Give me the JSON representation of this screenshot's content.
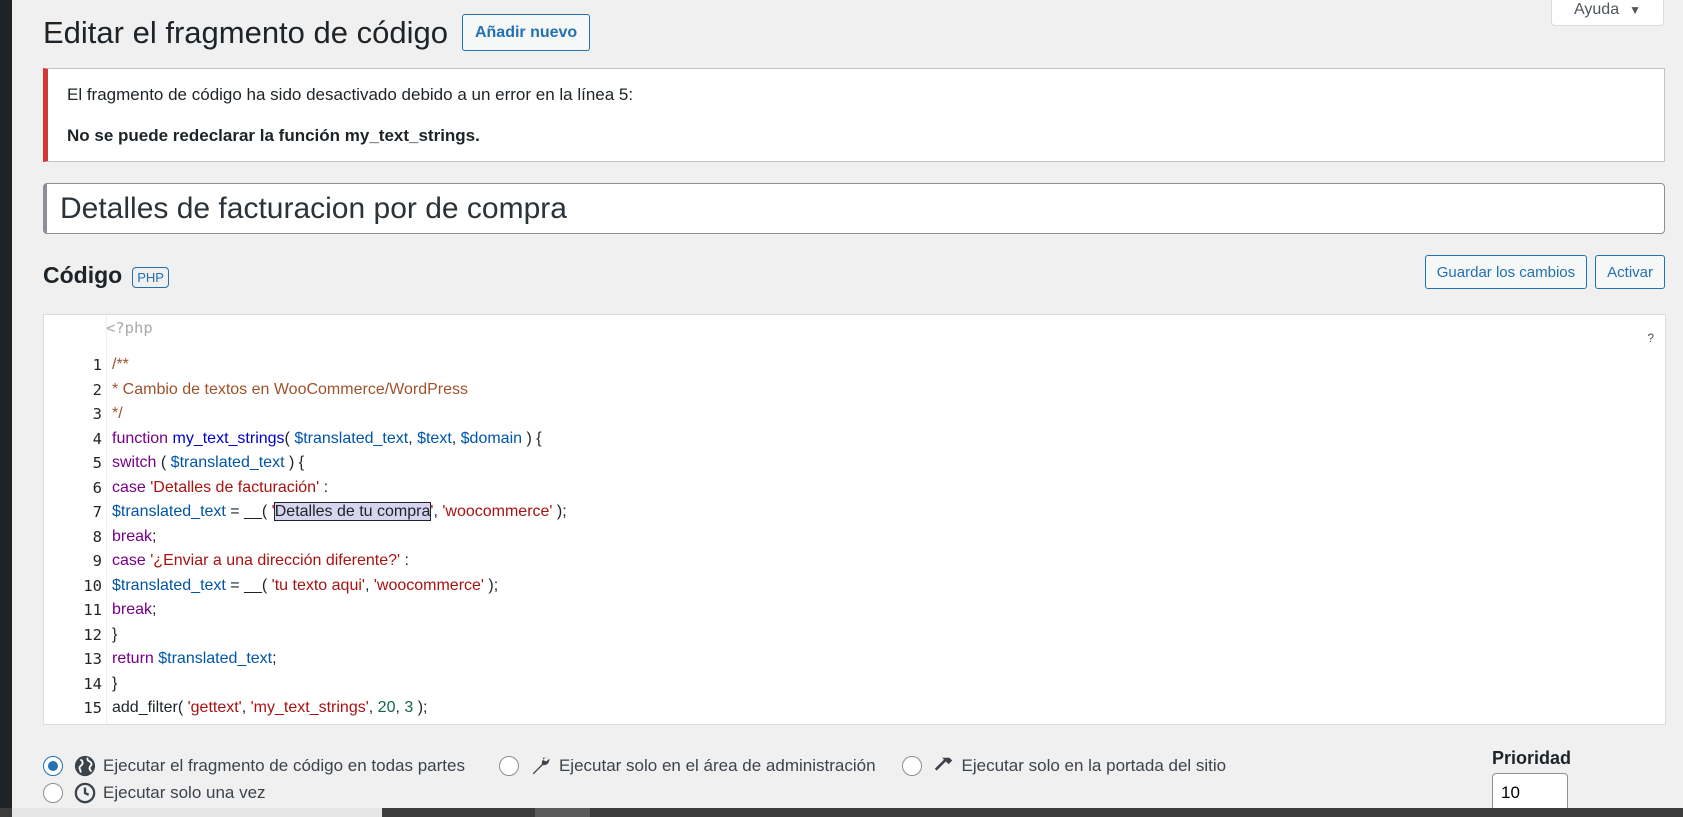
{
  "help": {
    "label": "Ayuda"
  },
  "header": {
    "title": "Editar el fragmento de código",
    "add_new": "Añadir nuevo"
  },
  "notice": {
    "message": "El fragmento de código ha sido desactivado debido a un error en la línea 5:",
    "detail": "No se puede redeclarar la función my_text_strings."
  },
  "snippet": {
    "title_value": "Detalles de facturacion por de compra"
  },
  "code_section": {
    "heading": "Código",
    "badge": "PHP",
    "save_label": "Guardar los cambios",
    "activate_label": "Activar",
    "php_open": "<?php",
    "help_mark": "?"
  },
  "code_lines": [
    {
      "n": "1",
      "parts": [
        [
          "cm",
          "/**"
        ]
      ]
    },
    {
      "n": "2",
      "parts": [
        [
          "cm",
          "* Cambio de textos en WooCommerce/WordPress"
        ]
      ]
    },
    {
      "n": "3",
      "parts": [
        [
          "cm",
          "*/"
        ]
      ]
    },
    {
      "n": "4",
      "parts": [
        [
          "kw",
          "function"
        ],
        [
          "pl",
          " "
        ],
        [
          "fn",
          "my_text_strings"
        ],
        [
          "pl",
          "( "
        ],
        [
          "vr",
          "$translated_text"
        ],
        [
          "pl",
          ", "
        ],
        [
          "vr",
          "$text"
        ],
        [
          "pl",
          ", "
        ],
        [
          "vr",
          "$domain"
        ],
        [
          "pl",
          " ) {"
        ]
      ]
    },
    {
      "n": "5",
      "parts": [
        [
          "kw",
          "switch"
        ],
        [
          "pl",
          " ( "
        ],
        [
          "vr",
          "$translated_text"
        ],
        [
          "pl",
          " ) {"
        ]
      ]
    },
    {
      "n": "6",
      "parts": [
        [
          "kw",
          "case"
        ],
        [
          "pl",
          " "
        ],
        [
          "st",
          "'Detalles de facturación'"
        ],
        [
          "pl",
          " :"
        ]
      ]
    },
    {
      "n": "7",
      "parts": [
        [
          "vr",
          "$translated_text"
        ],
        [
          "pl",
          " = __( "
        ],
        [
          "st",
          "'"
        ],
        [
          "sel",
          "Detalles de tu compra"
        ],
        [
          "st",
          "'"
        ],
        [
          "pl",
          ", "
        ],
        [
          "st",
          "'woocommerce'"
        ],
        [
          "pl",
          " );"
        ]
      ]
    },
    {
      "n": "8",
      "parts": [
        [
          "kw",
          "break"
        ],
        [
          "pl",
          ";"
        ]
      ]
    },
    {
      "n": "9",
      "parts": [
        [
          "kw",
          "case"
        ],
        [
          "pl",
          " "
        ],
        [
          "st",
          "'¿Enviar a una dirección diferente?'"
        ],
        [
          "pl",
          " :"
        ]
      ]
    },
    {
      "n": "10",
      "parts": [
        [
          "vr",
          "$translated_text"
        ],
        [
          "pl",
          " = __( "
        ],
        [
          "st",
          "'tu texto aqui'"
        ],
        [
          "pl",
          ", "
        ],
        [
          "st",
          "'woocommerce'"
        ],
        [
          "pl",
          " );"
        ]
      ]
    },
    {
      "n": "11",
      "parts": [
        [
          "kw",
          "break"
        ],
        [
          "pl",
          ";"
        ]
      ]
    },
    {
      "n": "12",
      "parts": [
        [
          "pl",
          "}"
        ]
      ]
    },
    {
      "n": "13",
      "parts": [
        [
          "kw",
          "return"
        ],
        [
          "pl",
          " "
        ],
        [
          "vr",
          "$translated_text"
        ],
        [
          "pl",
          ";"
        ]
      ]
    },
    {
      "n": "14",
      "parts": [
        [
          "pl",
          "}"
        ]
      ]
    },
    {
      "n": "15",
      "parts": [
        [
          "pl",
          "add_filter( "
        ],
        [
          "st",
          "'gettext'"
        ],
        [
          "pl",
          ", "
        ],
        [
          "st",
          "'my_text_strings'"
        ],
        [
          "pl",
          ", "
        ],
        [
          "nm",
          "20"
        ],
        [
          "pl",
          ", "
        ],
        [
          "nm",
          "3"
        ],
        [
          "pl",
          " );"
        ]
      ]
    }
  ],
  "scope": {
    "everywhere": "Ejecutar el fragmento de código en todas partes",
    "admin": "Ejecutar solo en el área de administración",
    "frontend": "Ejecutar solo en la portada del sitio",
    "once": "Ejecutar solo una vez",
    "selected": "everywhere"
  },
  "priority": {
    "label": "Prioridad",
    "value": "10"
  },
  "icons": {
    "globe": "globe-icon",
    "wrench": "wrench-icon",
    "hammer": "hammer-icon",
    "clock": "clock-icon"
  }
}
